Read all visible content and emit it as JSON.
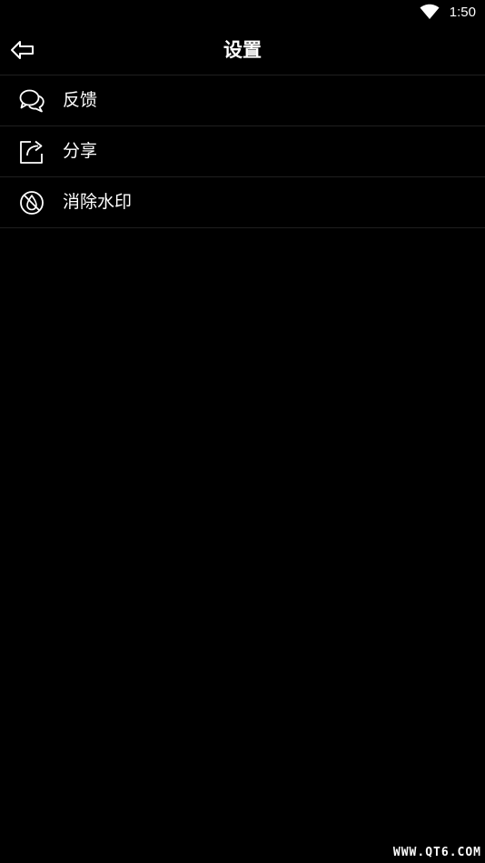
{
  "status_bar": {
    "time": "1:50",
    "wifi_icon": "wifi-icon"
  },
  "app_bar": {
    "back_icon": "back-arrow-icon",
    "title": "设置"
  },
  "menu": {
    "items": [
      {
        "icon": "chat-bubbles-icon",
        "label": "反馈"
      },
      {
        "icon": "share-icon",
        "label": "分享"
      },
      {
        "icon": "no-watermark-icon",
        "label": "消除水印"
      }
    ]
  },
  "watermark": "WWW.QT6.COM",
  "colors": {
    "background": "#000000",
    "text": "#ffffff",
    "divider": "#1f1f1f"
  }
}
